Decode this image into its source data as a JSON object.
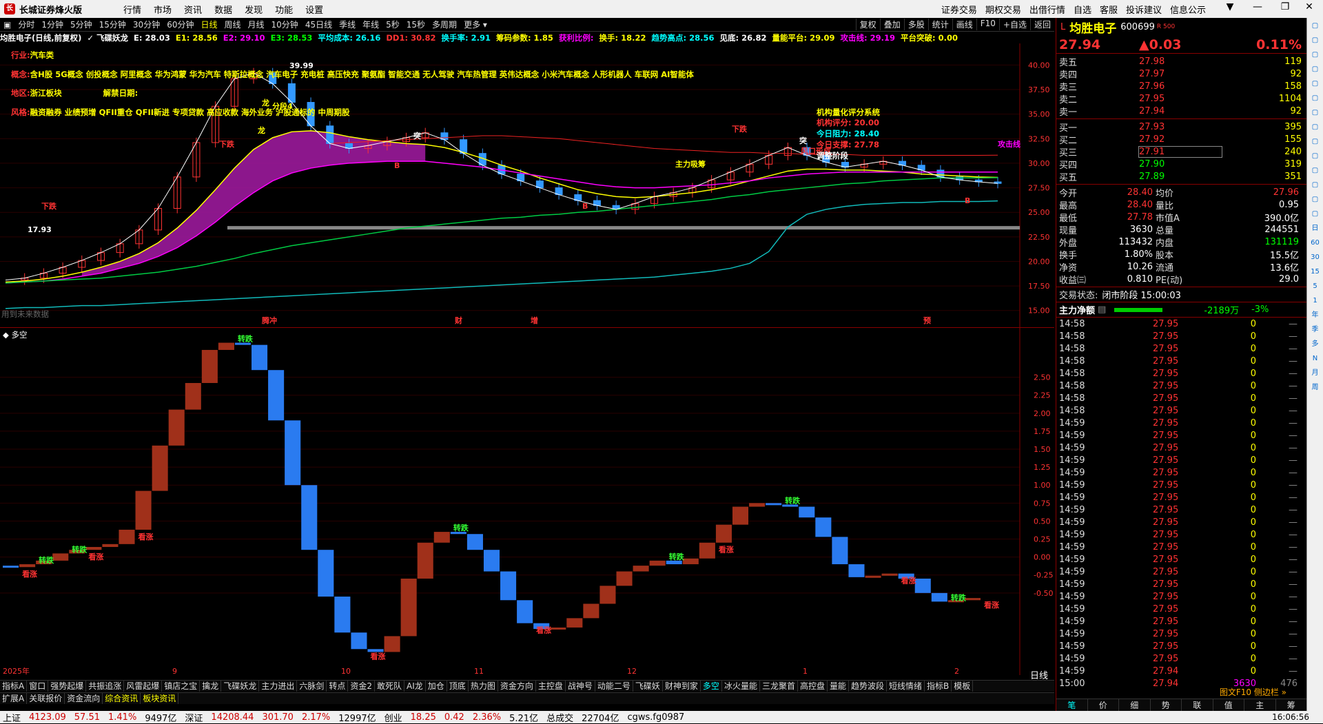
{
  "app": {
    "title": "长城证券烽火版"
  },
  "menu": [
    "行情",
    "市场",
    "资讯",
    "数据",
    "发现",
    "功能",
    "设置"
  ],
  "right_menu": [
    "证券交易",
    "期权交易",
    "出借行情",
    "自选",
    "客服",
    "投诉建议",
    "信息公示"
  ],
  "window_buttons": [
    "▼",
    "—",
    "❐",
    "✕"
  ],
  "toolbar": {
    "periods": [
      "分时",
      "1分钟",
      "5分钟",
      "15分钟",
      "30分钟",
      "60分钟",
      "日线",
      "周线",
      "月线",
      "10分钟",
      "45日线",
      "季线",
      "年线",
      "5秒",
      "15秒",
      "多周期",
      "更多"
    ],
    "active_period": "日线",
    "right": [
      "复权",
      "叠加",
      "多股",
      "统计",
      "画线",
      "F10",
      "+自选",
      "返回"
    ]
  },
  "info_line": [
    {
      "t": "均胜电子(日线,前复权)",
      "c": "#fff"
    },
    {
      "t": "✓ 飞碟妖龙",
      "c": "#fff"
    },
    {
      "t": "E: 28.03",
      "c": "#fff"
    },
    {
      "t": "E1: 28.56",
      "c": "#ff0"
    },
    {
      "t": "E2: 29.10",
      "c": "#f0f"
    },
    {
      "t": "E3: 28.53",
      "c": "#0f0"
    },
    {
      "t": "平均成本: 26.16",
      "c": "#0ff"
    },
    {
      "t": "DD1: 30.82",
      "c": "#f33"
    },
    {
      "t": "换手率: 2.91",
      "c": "#0ff"
    },
    {
      "t": "筹码参数: 1.85",
      "c": "#ff0"
    },
    {
      "t": "获利比例:",
      "c": "#f0f"
    },
    {
      "t": "换手: 18.22",
      "c": "#ff0"
    },
    {
      "t": "趋势高点: 28.56",
      "c": "#0ff"
    },
    {
      "t": "见底: 26.82",
      "c": "#fff"
    },
    {
      "t": "量能平台: 29.09",
      "c": "#ff0"
    },
    {
      "t": "攻击线: 29.19",
      "c": "#f0f"
    },
    {
      "t": "平台突破: 0.00",
      "c": "#ff0"
    }
  ],
  "overlay": {
    "industry_label": "行业:",
    "industry": "汽车类",
    "concept_label": "概念:",
    "concepts": "含H股 5G概念 创投概念 阿里概念 华为鸿蒙 华为汽车 特斯拉概念 汽车电子 充电桩 高压快充 聚氨酯 智能交通 无人驾驶 汽车热管理 英伟达概念 小米汽车概念 人形机器人 车联网 AI智能体",
    "region_label": "地区:",
    "region": "浙江板块",
    "unlock_label": "解禁日期:",
    "style_label": "风格:",
    "styles": "融资融券 业绩预增 QFII重仓 QFII新进 专项贷款 高应收款 海外业务 沪股通标的 中周期股",
    "score_title": "机构量化评分系统",
    "score": "机构评分: 20.00",
    "resistance": "今日阻力: 28.40",
    "support": "今日支撑: 27.78",
    "status": "调整阶段",
    "no_future": "用到未来数据"
  },
  "chart_labels": {
    "peak": "39.99",
    "low_price": "17.93",
    "xiadie": "下跌",
    "tu": "突",
    "B": "B",
    "xiaochou": "风口形成",
    "zhuli": "主力吸筹",
    "gongji": "攻击线",
    "longzhu": "龙",
    "fenduan": "分段4",
    "events": [
      "腾冲",
      "财",
      "增",
      "预"
    ]
  },
  "main_axis": [
    "40.00",
    "37.50",
    "35.00",
    "32.50",
    "30.00",
    "27.50",
    "25.00",
    "22.50",
    "20.00",
    "17.50",
    "15.00"
  ],
  "chart_data": [
    {
      "type": "line",
      "title": "",
      "series": [
        {
          "values": [
            18.1,
            18.3,
            18.8,
            19.4,
            20.1,
            20.9,
            21.8,
            23.2,
            25.4,
            28.6,
            32.1,
            35.8,
            38.6,
            39.2,
            38.1,
            36.2,
            33.8,
            32.0,
            31.5,
            31.8,
            32.2,
            32.6,
            33.1,
            32.4,
            31.0,
            29.8,
            28.9,
            28.2,
            27.5,
            26.8,
            26.2,
            25.7,
            25.3,
            25.9,
            26.6,
            27.0,
            27.5,
            28.3,
            29.1,
            29.9,
            30.8,
            31.6,
            30.8,
            30.1,
            29.6,
            29.9,
            30.2,
            29.8,
            29.3,
            28.6,
            28.3,
            28.1,
            27.94
          ]
        },
        {
          "name": "E1",
          "values": [
            17.9,
            18.0,
            18.2,
            18.5,
            18.9,
            19.4,
            20.0,
            20.8,
            21.9,
            23.4,
            25.2,
            27.3,
            29.5,
            31.4,
            32.6,
            33.2,
            33.3,
            33.1,
            32.7,
            32.4,
            32.2,
            32.0,
            31.9,
            31.6,
            31.1,
            30.5,
            29.8,
            29.2,
            28.5,
            27.9,
            27.3,
            26.9,
            26.6,
            26.5,
            26.6,
            26.8,
            27.0,
            27.3,
            27.7,
            28.2,
            28.7,
            29.2,
            29.4,
            29.4,
            29.3,
            29.3,
            29.2,
            29.1,
            28.9,
            28.8,
            28.7,
            28.6,
            28.56
          ]
        },
        {
          "name": "E2",
          "values": [
            17.8,
            17.9,
            18.0,
            18.2,
            18.5,
            18.8,
            19.3,
            19.8,
            20.5,
            21.4,
            22.6,
            24.0,
            25.6,
            27.0,
            28.2,
            29.0,
            29.5,
            29.8,
            30.0,
            30.1,
            30.2,
            30.2,
            30.2,
            30.0,
            29.8,
            29.6,
            29.3,
            29.0,
            28.7,
            28.4,
            28.1,
            27.8,
            27.6,
            27.5,
            27.5,
            27.6,
            27.7,
            27.8,
            28.0,
            28.2,
            28.5,
            28.7,
            28.9,
            29.0,
            29.1,
            29.1,
            29.1,
            29.1,
            29.1,
            29.1,
            29.1,
            29.1,
            29.1
          ]
        },
        {
          "name": "E3",
          "values": [
            17.8,
            17.9,
            18.0,
            18.1,
            18.2,
            18.3,
            18.5,
            18.7,
            18.9,
            19.2,
            19.5,
            19.9,
            20.3,
            20.8,
            21.2,
            21.6,
            21.9,
            22.2,
            22.5,
            22.8,
            23.1,
            23.4,
            23.6,
            23.8,
            24.0,
            24.2,
            24.4,
            24.5,
            24.7,
            24.8,
            25.0,
            25.1,
            25.3,
            25.5,
            25.7,
            25.9,
            26.1,
            26.3,
            26.6,
            26.8,
            27.1,
            27.3,
            27.5,
            27.7,
            27.9,
            28.0,
            28.2,
            28.3,
            28.4,
            28.5,
            28.5,
            28.5,
            28.53
          ]
        },
        {
          "name": "平均成本",
          "values": [
            15.2,
            15.3,
            15.3,
            15.4,
            15.5,
            15.5,
            15.6,
            15.7,
            15.8,
            15.9,
            16.0,
            16.1,
            16.2,
            16.3,
            16.4,
            16.5,
            16.6,
            16.7,
            16.8,
            16.9,
            17.0,
            17.1,
            17.2,
            17.3,
            17.4,
            17.5,
            17.6,
            17.7,
            17.8,
            17.9,
            18.0,
            18.1,
            18.2,
            18.3,
            18.4,
            18.6,
            18.8,
            19.0,
            19.3,
            19.8,
            21.0,
            23.5,
            24.8,
            25.3,
            25.6,
            25.8,
            25.9,
            26.0,
            26.0,
            26.1,
            26.1,
            26.1,
            26.16
          ]
        },
        {
          "name": "DD1",
          "values": [
            null,
            null,
            null,
            null,
            null,
            null,
            null,
            null,
            null,
            null,
            null,
            null,
            null,
            null,
            null,
            null,
            null,
            32.0,
            32.1,
            32.2,
            32.3,
            32.4,
            32.5,
            32.6,
            32.7,
            32.8,
            32.8,
            32.7,
            32.6,
            32.5,
            32.3,
            32.1,
            31.9,
            31.7,
            31.5,
            31.4,
            31.3,
            31.2,
            31.1,
            31.1,
            31.0,
            31.0,
            30.9,
            30.9,
            30.9,
            30.8,
            30.8,
            30.8,
            30.8,
            30.8,
            30.8,
            30.8,
            30.82
          ]
        }
      ]
    },
    {
      "type": "bar",
      "title": "多空",
      "series": [
        {
          "name": "多空",
          "values": [
            -0.12,
            -0.14,
            -0.1,
            -0.05,
            0.05,
            0.1,
            0.14,
            0.18,
            0.38,
            0.92,
            1.55,
            2.05,
            2.42,
            2.88,
            2.98,
            2.95,
            2.6,
            1.9,
            1.0,
            0.1,
            -0.55,
            -1.05,
            -1.28,
            -1.32,
            -1.1,
            -0.3,
            0.2,
            0.35,
            0.32,
            0.1,
            -0.2,
            -0.6,
            -0.92,
            -1.0,
            -0.98,
            -0.85,
            -0.65,
            -0.4,
            -0.2,
            -0.12,
            -0.05,
            -0.1,
            -0.02,
            0.2,
            0.45,
            0.7,
            0.75,
            0.73,
            0.7,
            0.55,
            0.28,
            -0.1,
            -0.28,
            -0.26,
            -0.23,
            -0.3,
            -0.5,
            -0.62,
            -0.6,
            -0.57
          ]
        }
      ],
      "labels": [
        "看涨",
        "转跌",
        "转跌",
        "看涨",
        "看涨",
        "转跌",
        "看涨",
        "转跌",
        "看涨",
        "转跌",
        "看涨",
        "转跌",
        "看涨",
        "转跌",
        "看涨"
      ],
      "yaxis": [
        "2.50",
        "2.25",
        "2.00",
        "1.75",
        "1.50",
        "1.25",
        "1.00",
        "0.75",
        "0.50",
        "0.25",
        "0.00",
        "-0.25",
        "-0.50"
      ],
      "xticks": [
        "2025年",
        "9",
        "10",
        "11",
        "12",
        "1",
        "2"
      ]
    }
  ],
  "tabs_row1": [
    "指标A",
    "窗口",
    "强势起爆",
    "共振追涨",
    "风雷起爆",
    "镇店之宝",
    "擒龙",
    "飞碟妖龙",
    "主力进出",
    "六脉剑",
    "转点",
    "资金2",
    "敢死队",
    "AI龙",
    "加仓",
    "顶底",
    "热力图",
    "资金方向",
    "主控盘",
    "战神号",
    "动能二号",
    "飞碟妖",
    "财神到家",
    "多空",
    "冰火量能",
    "三龙聚首",
    "高控盘",
    "量能",
    "趋势波段",
    "短线情绪",
    "指标B",
    "模板"
  ],
  "tabs_row1_active": "多空",
  "tabs_row2": [
    "扩展A",
    "关联报价",
    "资金流向",
    "综合资讯",
    "板块资讯"
  ],
  "bottom_right": {
    "period": "日线",
    "f10": "图文F10 侧边栏 »",
    "tabs": [
      "笔",
      "价",
      "细",
      "势",
      "联",
      "值",
      "主",
      "筹"
    ]
  },
  "right_panel": {
    "name": "均胜电子",
    "code": "600699",
    "badge": "R 500",
    "price": "27.94",
    "change": "▲0.03",
    "pct": "0.11%",
    "asks": [
      [
        "卖五",
        "27.98",
        "119"
      ],
      [
        "卖四",
        "27.97",
        "92"
      ],
      [
        "卖三",
        "27.96",
        "158"
      ],
      [
        "卖二",
        "27.95",
        "1104"
      ],
      [
        "卖一",
        "27.94",
        "92"
      ]
    ],
    "bids": [
      [
        "买一",
        "27.93",
        "395"
      ],
      [
        "买二",
        "27.92",
        "155"
      ],
      [
        "买三",
        "27.91",
        "240"
      ],
      [
        "买四",
        "27.90",
        "319"
      ],
      [
        "买五",
        "27.89",
        "351"
      ]
    ],
    "stats": [
      [
        "今开",
        "28.40",
        "均价",
        "27.96"
      ],
      [
        "最高",
        "28.40",
        "量比",
        "0.95"
      ],
      [
        "最低",
        "27.78",
        "市值A",
        "390.0亿"
      ],
      [
        "现量",
        "3630",
        "总量",
        "244551"
      ],
      [
        "外盘",
        "113432",
        "内盘",
        "131119"
      ],
      [
        "换手",
        "1.80%",
        "股本",
        "15.5亿"
      ],
      [
        "净资",
        "10.26",
        "流通",
        "13.6亿"
      ],
      [
        "收益㈢",
        "0.810",
        "PE(动)",
        "29.0"
      ]
    ],
    "trade_status_label": "交易状态:",
    "trade_status": "闭市阶段 15:00:03",
    "main_net_label": "主力净额",
    "main_net": "-2189万",
    "main_net_pct": "-3%",
    "ticks": [
      [
        "14:58",
        "27.95",
        "0"
      ],
      [
        "14:58",
        "27.95",
        "0"
      ],
      [
        "14:58",
        "27.95",
        "0"
      ],
      [
        "14:58",
        "27.95",
        "0"
      ],
      [
        "14:58",
        "27.95",
        "0"
      ],
      [
        "14:58",
        "27.95",
        "0"
      ],
      [
        "14:58",
        "27.95",
        "0"
      ],
      [
        "14:58",
        "27.95",
        "0"
      ],
      [
        "14:59",
        "27.95",
        "0"
      ],
      [
        "14:59",
        "27.95",
        "0"
      ],
      [
        "14:59",
        "27.95",
        "0"
      ],
      [
        "14:59",
        "27.95",
        "0"
      ],
      [
        "14:59",
        "27.95",
        "0"
      ],
      [
        "14:59",
        "27.95",
        "0"
      ],
      [
        "14:59",
        "27.95",
        "0"
      ],
      [
        "14:59",
        "27.95",
        "0"
      ],
      [
        "14:59",
        "27.95",
        "0"
      ],
      [
        "14:59",
        "27.95",
        "0"
      ],
      [
        "14:59",
        "27.95",
        "0"
      ],
      [
        "14:59",
        "27.95",
        "0"
      ],
      [
        "14:59",
        "27.95",
        "0"
      ],
      [
        "14:59",
        "27.95",
        "0"
      ],
      [
        "14:59",
        "27.95",
        "0"
      ],
      [
        "14:59",
        "27.95",
        "0"
      ],
      [
        "14:59",
        "27.95",
        "0"
      ],
      [
        "14:59",
        "27.95",
        "0"
      ],
      [
        "14:59",
        "27.95",
        "0"
      ],
      [
        "14:59",
        "27.95",
        "0"
      ],
      [
        "14:59",
        "27.94",
        "0"
      ],
      [
        "15:00",
        "27.94",
        "3630",
        "476"
      ]
    ]
  },
  "vscroll": [
    "周",
    "月",
    "N",
    "多",
    "季",
    "年",
    "1",
    "5",
    "15",
    "30",
    "60",
    "日"
  ],
  "status": [
    {
      "t": "上证",
      "c": "#000"
    },
    {
      "t": "4123.09",
      "c": "#c00"
    },
    {
      "t": "57.51",
      "c": "#c00"
    },
    {
      "t": "1.41%",
      "c": "#c00"
    },
    {
      "t": "9497亿",
      "c": "#000"
    },
    {
      "t": "深证",
      "c": "#000"
    },
    {
      "t": "14208.44",
      "c": "#c00"
    },
    {
      "t": "301.70",
      "c": "#c00"
    },
    {
      "t": "2.17%",
      "c": "#c00"
    },
    {
      "t": "12997亿",
      "c": "#000"
    },
    {
      "t": "创业",
      "c": "#000"
    },
    {
      "t": "18.25",
      "c": "#c00"
    },
    {
      "t": "0.42",
      "c": "#c00"
    },
    {
      "t": "2.36%",
      "c": "#c00"
    },
    {
      "t": "5.21亿",
      "c": "#000"
    },
    {
      "t": "总成交",
      "c": "#000"
    },
    {
      "t": "22704亿",
      "c": "#000"
    },
    {
      "t": "cgws.fg0987",
      "c": "#000"
    }
  ],
  "clock": "16:06:56"
}
